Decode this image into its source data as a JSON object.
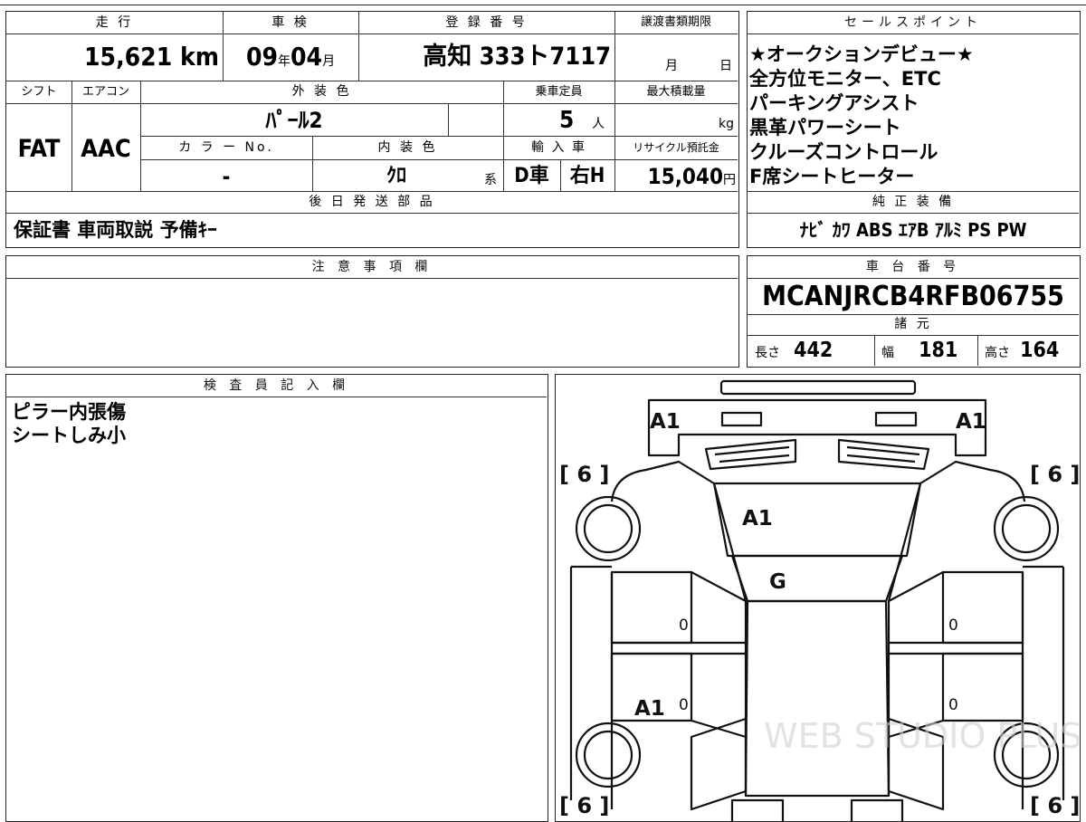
{
  "headers": {
    "mileage": "走 行",
    "inspection": "車 検",
    "registration": "登 録 番 号",
    "transfer_docs": "譲渡書類期限",
    "sales_points": "セールスポイント",
    "shift": "シフト",
    "aircon": "エアコン",
    "exterior_color": "外 装 色",
    "capacity": "乗車定員",
    "max_load": "最大積載量",
    "color_no": "カ ラ ー No.",
    "interior_color": "内 装 色",
    "import": "輸 入 車",
    "recycle": "リサイクル預託金",
    "later_parts": "後 日 発 送 部 品",
    "genuine_equipment": "純 正 装 備",
    "notes": "注 意 事 項 欄",
    "chassis_no": "車 台 番 号",
    "specs": "諸 元",
    "inspector": "検 査 員 記 入 欄"
  },
  "mileage": {
    "value": "15,621",
    "unit": "km"
  },
  "inspection": {
    "year": "09",
    "year_unit": "年",
    "month": "04",
    "month_unit": "月"
  },
  "registration": "高知 333ト7117",
  "transfer_docs": {
    "month_unit": "月",
    "day_unit": "日"
  },
  "sales_points": [
    "★オークションデビュー★",
    "全方位モニター、ETC",
    "パーキングアシスト",
    "黒革パワーシート",
    "クルーズコントロール",
    "F席シートヒーター"
  ],
  "shift": "FAT",
  "aircon": "AAC",
  "exterior_color": "ﾊﾟｰﾙ2",
  "capacity": {
    "value": "5",
    "unit": "人"
  },
  "max_load": {
    "unit": "kg"
  },
  "color_no": "-",
  "interior_color": {
    "value": "ｸﾛ",
    "unit": "系"
  },
  "import": {
    "drive": "D車",
    "steering": "右H"
  },
  "recycle": {
    "value": "15,040",
    "unit": "円"
  },
  "later_parts": "保証書 車両取説 予備ｷｰ",
  "genuine_equipment": "ﾅﾋﾞ ｶﾜ ABS ｴｱB ｱﾙﾐ PS PW",
  "notes": "",
  "chassis_no": "MCANJRCB4RFB06755",
  "specs": {
    "length_label": "長さ",
    "length": "442",
    "width_label": "幅",
    "width": "181",
    "height_label": "高さ",
    "height": "164"
  },
  "inspector_notes": [
    "ピラー内張傷",
    "シートしみ小"
  ],
  "diagram": {
    "tire_left_front": "[ 6 ]",
    "tire_right_front": "[ 6 ]",
    "tire_left_rear": "[ 6 ]",
    "tire_right_rear": "[ 6 ]",
    "mark_front_left": "A1",
    "mark_front_right": "A1",
    "mark_hood": "A1",
    "mark_windshield": "G",
    "mark_left_door_front": "0",
    "mark_left_door_rear": "0",
    "mark_right_door_front": "0",
    "mark_right_door_rear": "0",
    "mark_left_rear": "A1",
    "watermark": "WEB STUDIO PLUS"
  }
}
